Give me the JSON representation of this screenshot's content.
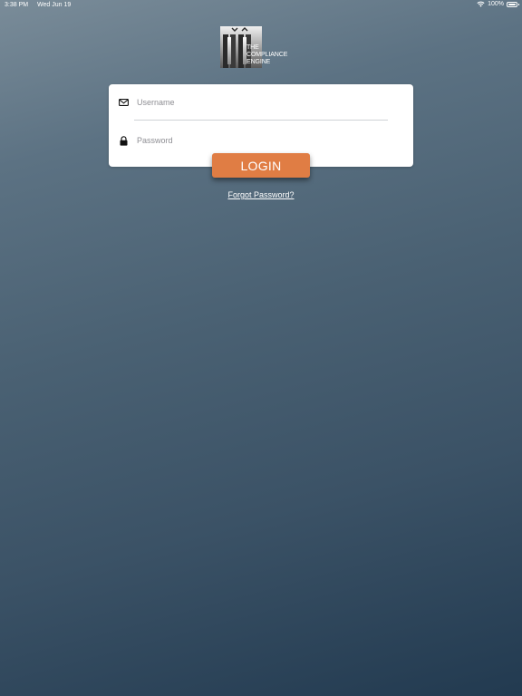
{
  "status_bar": {
    "time": "3:38 PM",
    "date": "Wed Jun 19",
    "battery": "100%",
    "wifi_icon": "wifi-icon",
    "battery_icon": "battery-icon"
  },
  "logo": {
    "line1": "THE",
    "line2": "COMPLIANCE",
    "line3": "ENGINE"
  },
  "login_form": {
    "username": {
      "placeholder": "Username",
      "value": "",
      "icon": "envelope-icon"
    },
    "password": {
      "placeholder": "Password",
      "value": "",
      "icon": "lock-icon"
    },
    "login_label": "LOGIN",
    "forgot_label": "Forgot Password?"
  },
  "colors": {
    "accent": "#e07d44",
    "background_top": "#7a8c99",
    "background_bottom": "#223a50",
    "card": "#ffffff"
  }
}
